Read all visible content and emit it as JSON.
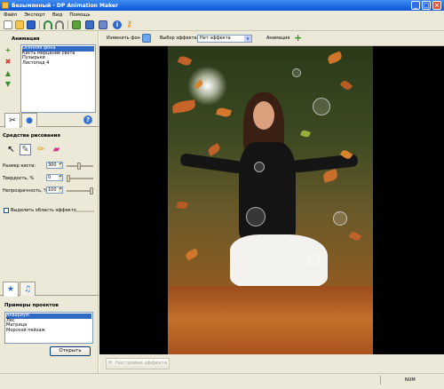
{
  "window": {
    "title": "Безымянный - DP Animation Maker"
  },
  "menu": {
    "items": [
      "Файл",
      "Экспорт",
      "Вид",
      "Помощь"
    ]
  },
  "toolbar": {
    "icons": [
      "new-icon",
      "open-icon",
      "save-icon",
      "undo-icon",
      "redo-icon",
      "settings-icon",
      "export-icon",
      "film-icon",
      "info-icon",
      "key-icon"
    ]
  },
  "left": {
    "animation_label": "Анимация",
    "animation_list": [
      "Осенняя фона",
      "Кисть мерцание света",
      "Пузырьки",
      "Листопад 4"
    ],
    "drawing_tools_label": "Средства рисования",
    "brush_size": {
      "label": "Размер кисти:",
      "value": "300"
    },
    "hardness": {
      "label": "Твердость, %",
      "value": "0"
    },
    "opacity": {
      "label": "Непрозрачность, %",
      "value": "100"
    },
    "highlight": {
      "label": "Выделить область эффекта"
    },
    "examples_label": "Примеры проектов",
    "examples_list": [
      "Аквариум",
      "Лес",
      "Матрица",
      "Морской пейзаж"
    ],
    "open_button": "Открыть"
  },
  "topbar": {
    "change_bg": "Изменить фон",
    "effect_choice": "Выбор эффекта",
    "effect_value": "Нет эффекта",
    "animation": "Анимация"
  },
  "bottombar": {
    "effect_settings": "Настройки эффекта"
  },
  "status": {
    "num": "NUM"
  },
  "colors": {
    "title_start": "#3f8cf3",
    "title_end": "#0a55d6",
    "panel": "#ece9d8",
    "selection": "#316ac5"
  }
}
